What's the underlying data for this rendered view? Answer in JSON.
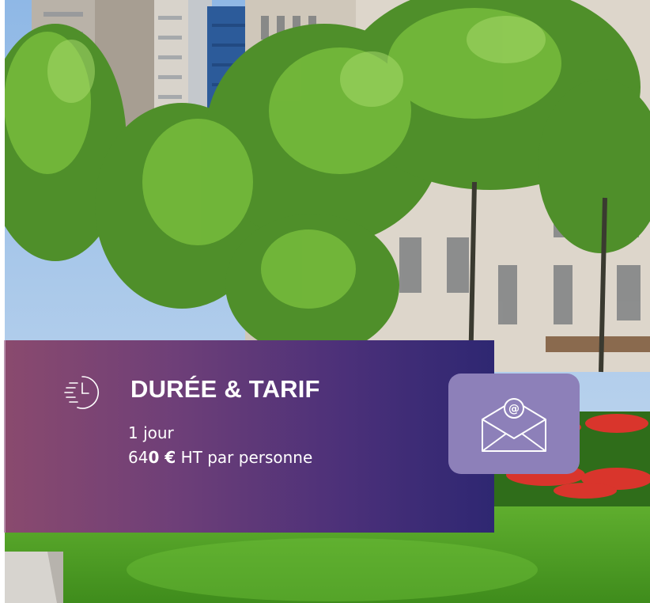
{
  "card": {
    "title": "DURÉE & TARIF",
    "duration": "1 jour",
    "price_prefix": "64",
    "price_bold": "0 €",
    "price_suffix": " HT par personne",
    "clock_icon": "clock-history-icon",
    "gradient_colors": [
      "#8a4a6e",
      "#6e3f78",
      "#4b3079",
      "#2e2772"
    ]
  },
  "contact": {
    "icon": "mail-at-icon",
    "color": "#8d80b9"
  },
  "background": {
    "subject": "city-park-photo"
  }
}
